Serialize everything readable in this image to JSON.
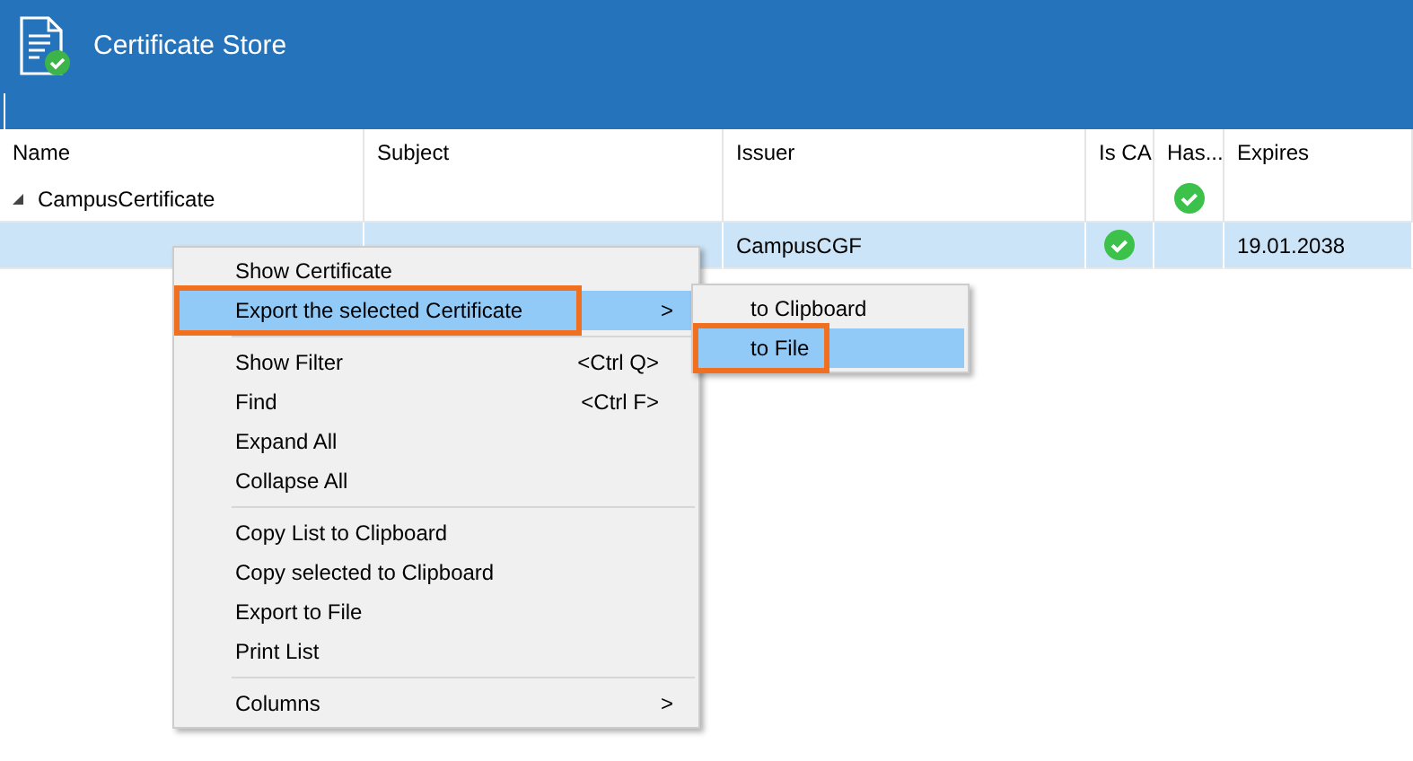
{
  "window": {
    "title": "Certificate Store"
  },
  "table": {
    "columns": [
      "Name",
      "Subject",
      "Issuer",
      "Is CA",
      "Has...",
      "Expires"
    ],
    "rows": [
      {
        "kind": "group",
        "expanded": true,
        "selected": false,
        "cells": [
          {
            "text": "CampusCertificate"
          },
          {},
          {},
          {},
          {
            "check": true
          },
          {}
        ]
      },
      {
        "kind": "item",
        "selected": true,
        "cells": [
          {},
          {},
          {
            "text": "CampusCGF"
          },
          {
            "check": true
          },
          {},
          {
            "text": "19.01.2038"
          }
        ]
      }
    ]
  },
  "context_menu": {
    "items": [
      {
        "kind": "item",
        "label": "Show Certificate",
        "highlighted": false,
        "annotated": false
      },
      {
        "kind": "item",
        "label": "Export the selected Certificate",
        "submenu": ">",
        "highlighted": true,
        "annotated": true
      },
      {
        "kind": "separator"
      },
      {
        "kind": "item",
        "label": "Show Filter",
        "shortcut": "<Ctrl Q>",
        "highlighted": false,
        "annotated": false
      },
      {
        "kind": "item",
        "label": "Find",
        "shortcut": "<Ctrl F>",
        "highlighted": false,
        "annotated": false
      },
      {
        "kind": "item",
        "label": "Expand All",
        "highlighted": false,
        "annotated": false
      },
      {
        "kind": "item",
        "label": "Collapse All",
        "highlighted": false,
        "annotated": false
      },
      {
        "kind": "separator"
      },
      {
        "kind": "item",
        "label": "Copy List to Clipboard",
        "highlighted": false,
        "annotated": false
      },
      {
        "kind": "item",
        "label": "Copy selected to Clipboard",
        "highlighted": false,
        "annotated": false
      },
      {
        "kind": "item",
        "label": "Export to File",
        "highlighted": false,
        "annotated": false
      },
      {
        "kind": "item",
        "label": "Print List",
        "highlighted": false,
        "annotated": false
      },
      {
        "kind": "separator"
      },
      {
        "kind": "item",
        "label": "Columns",
        "submenu": ">",
        "highlighted": false,
        "annotated": false
      }
    ]
  },
  "submenu": {
    "items": [
      {
        "kind": "item",
        "label": "to Clipboard",
        "highlighted": false,
        "annotated": false
      },
      {
        "kind": "item",
        "label": "to File",
        "highlighted": true,
        "annotated": true
      }
    ]
  }
}
